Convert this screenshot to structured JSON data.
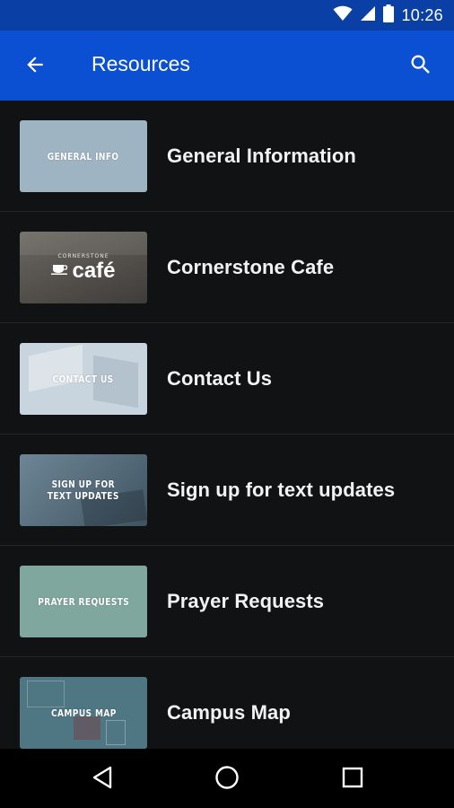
{
  "status_bar": {
    "time": "10:26"
  },
  "app_bar": {
    "title": "Resources"
  },
  "colors": {
    "status_bar": "#0a3fa6",
    "app_bar": "#0b4fd3",
    "background": "#111214",
    "divider": "#25262a"
  },
  "items": [
    {
      "label": "General Information",
      "thumb_text": "GENERAL INFO",
      "thumb_color": "#9fb4c2"
    },
    {
      "label": "Cornerstone Cafe",
      "thumb_text": "café",
      "thumb_subtext": "CORNERSTONE",
      "thumb_color": "#5a5752"
    },
    {
      "label": "Contact Us",
      "thumb_text": "CONTACT US",
      "thumb_color": "#c7d3dc"
    },
    {
      "label": "Sign up for text updates",
      "thumb_text": "SIGN UP FOR\nTEXT UPDATES",
      "thumb_color": "#5c7384"
    },
    {
      "label": "Prayer Requests",
      "thumb_text": "PRAYER REQUESTS",
      "thumb_color": "#7fa79e"
    },
    {
      "label": "Campus Map",
      "thumb_text": "CAMPUS MAP",
      "thumb_color": "#4f7683"
    }
  ],
  "icons": {
    "back": "arrow-left-icon",
    "search": "search-icon",
    "nav_back": "triangle-back-icon",
    "nav_home": "circle-home-icon",
    "nav_recents": "square-recents-icon"
  }
}
